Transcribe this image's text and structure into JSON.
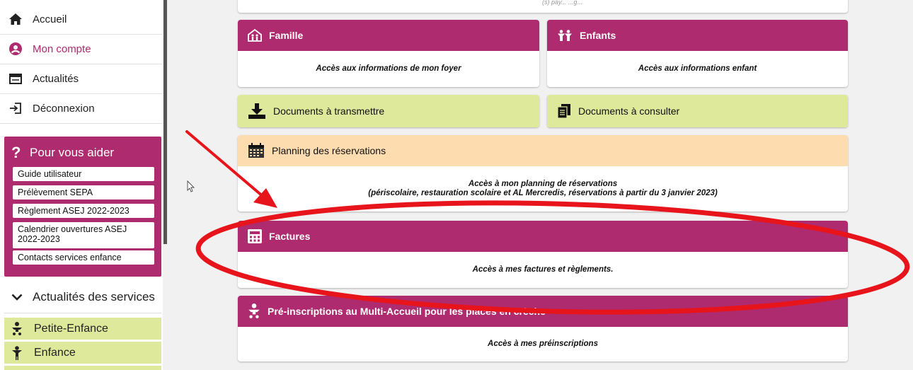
{
  "nav": {
    "home": "Accueil",
    "account": "Mon compte",
    "news": "Actualités",
    "logout": "Déconnexion"
  },
  "help": {
    "title": "Pour vous aider",
    "links": [
      "Guide utilisateur",
      "Prélèvement SEPA",
      "Règlement ASEJ 2022-2023",
      "Calendrier ouvertures ASEJ 2022-2023",
      "Contacts services enfance"
    ]
  },
  "services": {
    "header": "Actualités des services",
    "items": [
      "Petite-Enfance",
      "Enfance"
    ]
  },
  "cards": {
    "top_partial": "(s) pay... ...g...",
    "famille": {
      "title": "Famille",
      "body": "Accès aux informations de mon foyer"
    },
    "enfants": {
      "title": "Enfants",
      "body": "Accès aux informations enfant"
    },
    "docs_send": {
      "title": "Documents à transmettre"
    },
    "docs_view": {
      "title": "Documents à consulter"
    },
    "planning": {
      "title": "Planning des réservations",
      "body_line1": "Accès à mon planning de réservations",
      "body_line2": "(périscolaire, restauration scolaire et AL Mercredis, réservations à partir du 3 janvier 2023)"
    },
    "factures": {
      "title": "Factures",
      "body": "Accès à mes factures et règlements."
    },
    "preinscriptions": {
      "title": "Pré-inscriptions au Multi-Accueil pour les places en crèche",
      "body": "Accès à mes préinscriptions"
    }
  },
  "colors": {
    "accent": "#ad2b6e",
    "green": "#dfe99c",
    "peach": "#fddcb0",
    "annotation": "#e8141b"
  }
}
